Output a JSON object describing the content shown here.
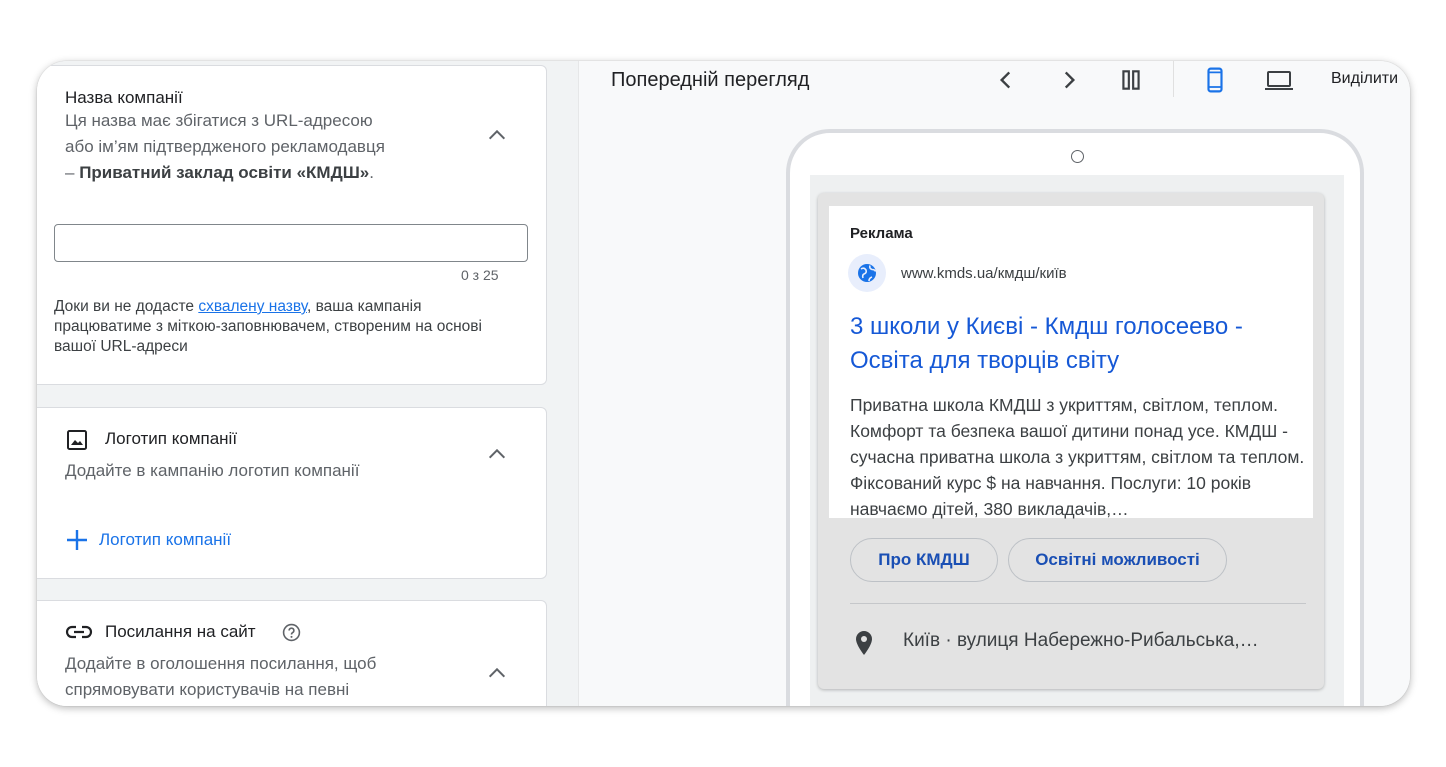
{
  "business_name": {
    "title": "Назва компанії",
    "subtitle_1": "Ця назва має збігатися з URL-адресою",
    "subtitle_2": "або ім’ям підтвердженого рекламодавця",
    "subtitle_3_prefix": "– ",
    "subtitle_3_bold": "Приватний заклад освіти «КМДШ»",
    "subtitle_3_suffix": ".",
    "input_value": "",
    "counter": "0 з 25",
    "note_prefix": "Доки ви не додасте ",
    "note_link": "схвалену назву",
    "note_suffix": ", ваша кампанія працюватиме з міткою-заповнювачем, створеним на основі вашої URL-адреси"
  },
  "logo": {
    "title": "Логотип компанії",
    "subtitle": "Додайте в кампанію логотип компанії",
    "add_label": "Логотип компанії"
  },
  "sitelinks": {
    "title": "Посилання на сайт",
    "subtitle_1": "Додайте в оголошення посилання, щоб",
    "subtitle_2": "спрямовувати користувачів на певні"
  },
  "preview": {
    "title": "Попередній перегляд",
    "highlight_label": "Виділити"
  },
  "ad": {
    "label": "Реклама",
    "url": "www.kmds.ua/кмдш/київ",
    "headline": "3 школи у Києві - Кмдш голосеево - Освіта для творців світу",
    "description": "Приватна школа КМДШ з укриттям, світлом, теплом. Комфорт та безпека вашої дитини понад усе. КМДШ - сучасна приватна школа з укриттям, світлом та теплом. Фіксований курс $ на навчання. Послуги: 10 років навчаємо дітей, 380 викладачів,…",
    "sitelink_1": "Про КМДШ",
    "sitelink_2": "Освітні можливості",
    "location": "Київ · вулиця Набережно-Рибальська,…"
  },
  "colors": {
    "accent_blue": "#1a73e8",
    "headline_blue": "#1558d6"
  }
}
